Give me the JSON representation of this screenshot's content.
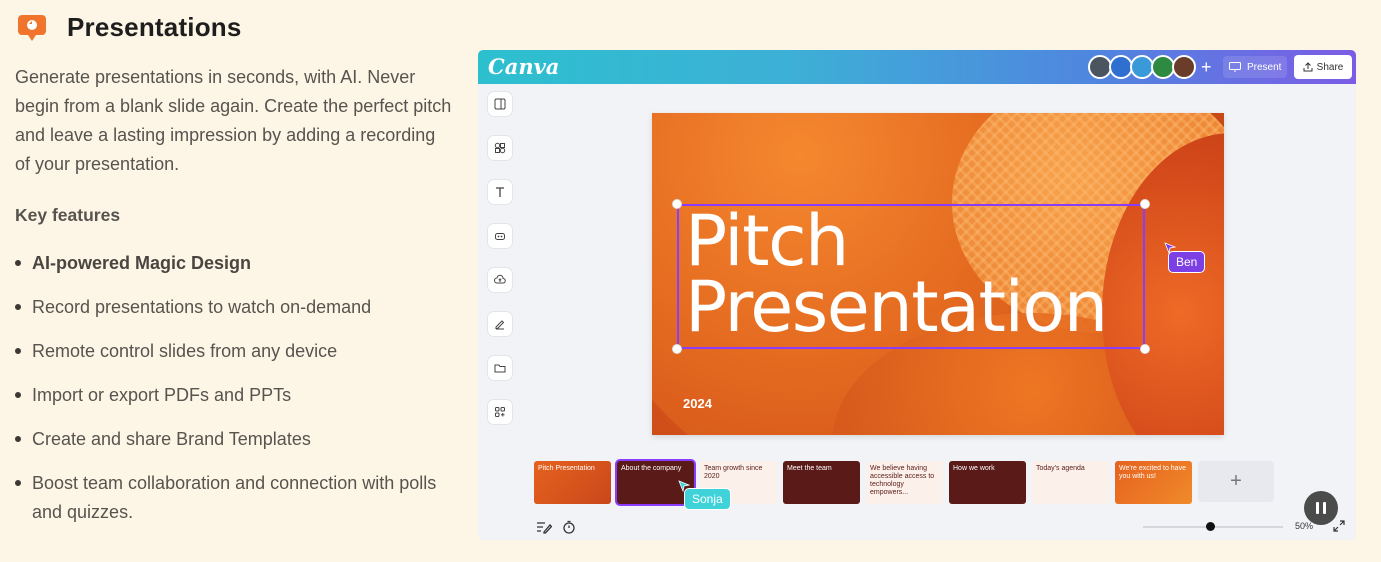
{
  "header": {
    "title": "Presentations",
    "icon": "presentation-chat-icon"
  },
  "description": "Generate presentations in seconds, with AI. Never begin from a blank slide again. Create the perfect pitch and leave a lasting impression by adding a recording of your presentation.",
  "key_features": {
    "title": "Key features",
    "items": [
      "AI-powered Magic Design",
      "Record presentations to watch on-demand",
      "Remote control slides from any device",
      "Import or export PDFs and PPTs",
      "Create and share Brand Templates",
      "Boost team collaboration and connection with polls and quizzes."
    ]
  },
  "app": {
    "logo": "Canva",
    "add_collaborator": "+",
    "present_label": "Present",
    "share_label": "Share",
    "slide": {
      "title_line1": "Pitch",
      "title_line2": "Presentation",
      "year": "2024"
    },
    "cursors": {
      "ben": "Ben",
      "sonja": "Sonja"
    },
    "thumbnails": [
      {
        "text": "Pitch Presentation"
      },
      {
        "text": "About the company"
      },
      {
        "text": "Team growth since 2020"
      },
      {
        "text": "Meet the team"
      },
      {
        "text": "We believe having accessible access to technology empowers..."
      },
      {
        "text": "How we work"
      },
      {
        "text": "Today's agenda"
      },
      {
        "text": "We're excited to have you with us!"
      }
    ],
    "add_page": "+",
    "zoom": "50%"
  },
  "colors": {
    "accent": "#8b3dff",
    "brand_orange": "#e6621f",
    "background": "#fdf6e6"
  }
}
